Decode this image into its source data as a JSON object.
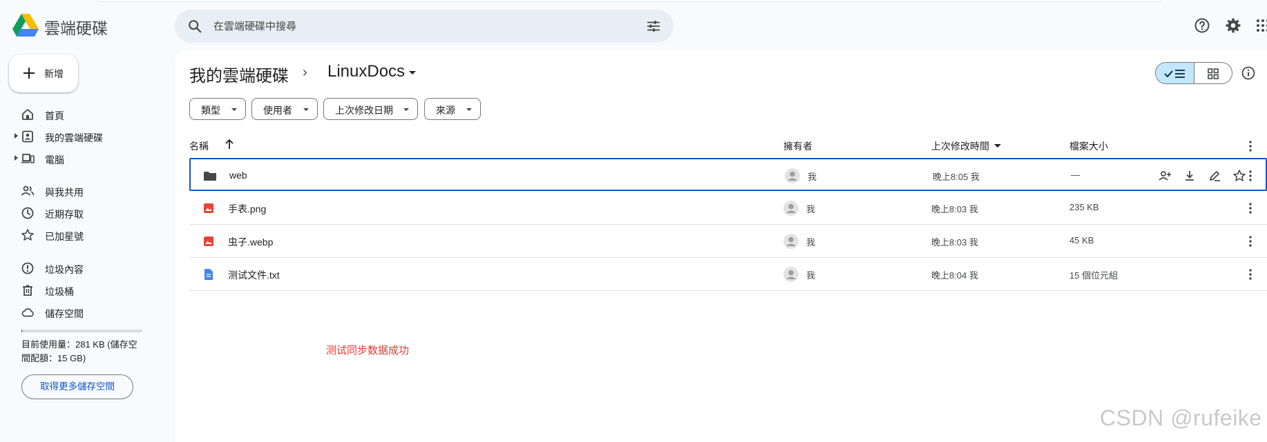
{
  "app": {
    "brand": "雲端硬碟"
  },
  "search": {
    "placeholder": "在雲端硬碟中搜尋"
  },
  "sidebar": {
    "new_label": "新增",
    "items": [
      {
        "label": "首頁"
      },
      {
        "label": "我的雲端硬碟"
      },
      {
        "label": "電腦"
      },
      {
        "label": "與我共用"
      },
      {
        "label": "近期存取"
      },
      {
        "label": "已加星號"
      },
      {
        "label": "垃圾內容"
      },
      {
        "label": "垃圾桶"
      },
      {
        "label": "儲存空間"
      }
    ],
    "storage_text": "目前使用量：281 KB (儲存空間配額：15 GB)",
    "storage_used_fraction": 2e-05,
    "more_storage_label": "取得更多儲存空間"
  },
  "breadcrumb": {
    "root": "我的雲端硬碟",
    "separator": "›",
    "current": "LinuxDocs"
  },
  "filters": [
    "類型",
    "使用者",
    "上次修改日期",
    "來源"
  ],
  "table": {
    "headers": {
      "name": "名稱",
      "owner": "擁有者",
      "modified": "上次修改時間",
      "size": "檔案大小"
    },
    "rows": [
      {
        "name": "web",
        "owner": "我",
        "modified": "晚上8:05 我",
        "size": "—",
        "type": "folder"
      },
      {
        "name": "手表.png",
        "owner": "我",
        "modified": "晚上8:03 我",
        "size": "235 KB",
        "type": "image"
      },
      {
        "name": "虫子.webp",
        "owner": "我",
        "modified": "晚上8:03 我",
        "size": "45 KB",
        "type": "image"
      },
      {
        "name": "测试文件.txt",
        "owner": "我",
        "modified": "晚上8:04 我",
        "size": "15 個位元組",
        "type": "doc"
      }
    ]
  },
  "annotation": "测试同步数据成功",
  "watermark": "CSDN @rufeike",
  "colors": {
    "accent": "#0b57d0",
    "selected_view": "#c2e7ff",
    "image_icon": "#ea4335",
    "doc_icon": "#4285f4",
    "annotation": "#e53935"
  }
}
